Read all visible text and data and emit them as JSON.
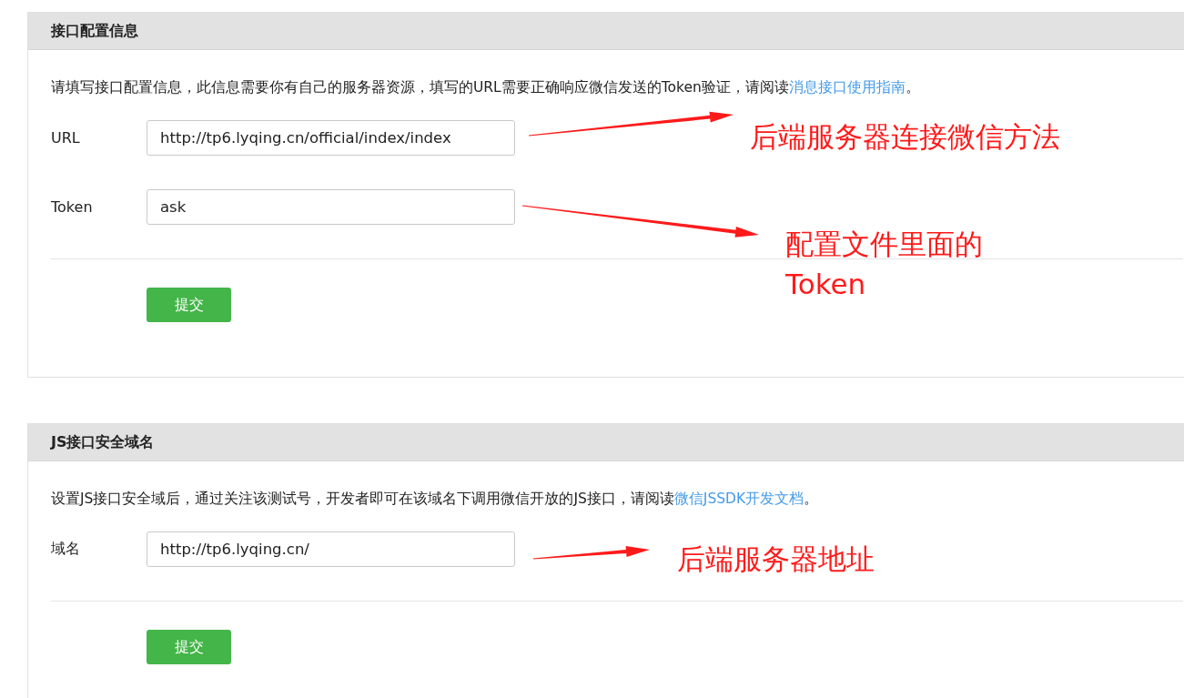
{
  "sections": [
    {
      "title": "接口配置信息",
      "description": {
        "text": "请填写接口配置信息，此信息需要你有自己的服务器资源，填写的URL需要正确响应微信发送的Token验证，请阅读",
        "link": "消息接口使用指南",
        "end": "。"
      },
      "fields": [
        {
          "label": "URL",
          "value": "http://tp6.lyqing.cn/official/index/index",
          "annotation": "后端服务器连接微信方法"
        },
        {
          "label": "Token",
          "value": "ask",
          "annotation": "配置文件里面的Token"
        }
      ],
      "submit_button": "提交"
    },
    {
      "title": "JS接口安全域名",
      "description": {
        "text": "设置JS接口安全域后，通过关注该测试号，开发者即可在该域名下调用微信开放的JS接口，请阅读",
        "link": "微信JSSDK开发文档",
        "end": "。"
      },
      "fields": [
        {
          "label": "域名",
          "value": "http://tp6.lyqing.cn/",
          "annotation": "后端服务器地址"
        }
      ],
      "submit_button": "提交"
    }
  ]
}
